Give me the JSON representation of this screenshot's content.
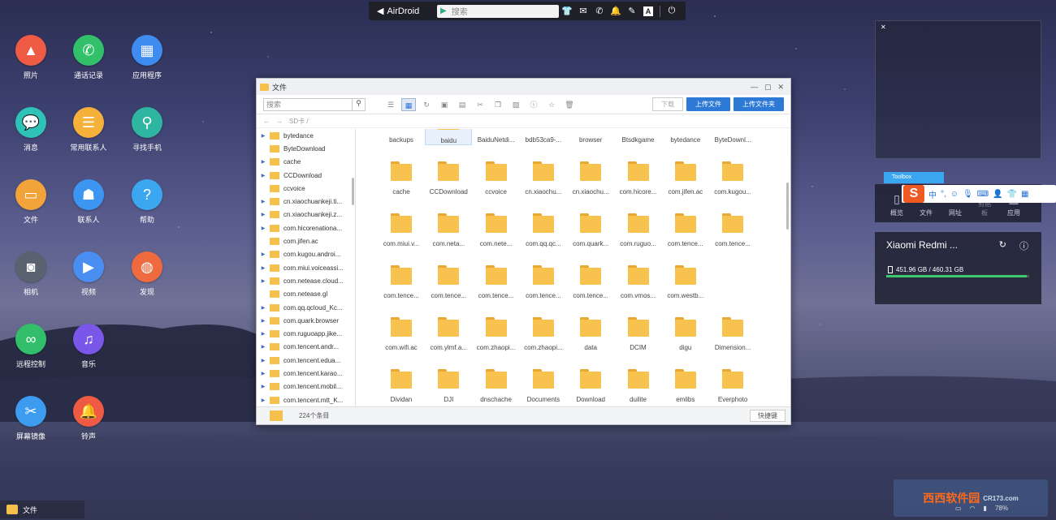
{
  "topbar": {
    "logo": "AirDroid",
    "search_placeholder": "搜索",
    "icons": [
      "shirt-icon",
      "mail-icon",
      "phone-icon",
      "bell-icon",
      "pen-icon",
      "font-icon",
      "power-icon"
    ]
  },
  "desktop": [
    {
      "label": "照片",
      "color": "#ef5b45",
      "icon": "photo-icon"
    },
    {
      "label": "通话记录",
      "color": "#33c06a",
      "icon": "phone-icon"
    },
    {
      "label": "应用程序",
      "color": "#3e8cf0",
      "icon": "apps-icon"
    },
    {
      "label": "消息",
      "color": "#2fc3b8",
      "icon": "message-icon"
    },
    {
      "label": "常用联系人",
      "color": "#f6b13a",
      "icon": "contact-card-icon"
    },
    {
      "label": "寻找手机",
      "color": "#2fb6a2",
      "icon": "location-icon"
    },
    {
      "label": "文件",
      "color": "#f2a33a",
      "icon": "folder-icon"
    },
    {
      "label": "联系人",
      "color": "#3d95f2",
      "icon": "contacts-icon"
    },
    {
      "label": "帮助",
      "color": "#3aa7f0",
      "icon": "help-icon"
    },
    {
      "label": "相机",
      "color": "#5a6270",
      "icon": "camera-icon"
    },
    {
      "label": "视频",
      "color": "#4b8ef2",
      "icon": "video-icon"
    },
    {
      "label": "发现",
      "color": "#ef6a3e",
      "icon": "planet-icon"
    },
    {
      "label": "远程控制",
      "color": "#32be6a",
      "icon": "binoculars-icon"
    },
    {
      "label": "音乐",
      "color": "#7a57e8",
      "icon": "music-icon"
    },
    {
      "label": "屏幕镜像",
      "color": "#3d9cf0",
      "icon": "scissors-icon"
    },
    {
      "label": "铃声",
      "color": "#ef5a45",
      "icon": "bell-icon"
    }
  ],
  "window": {
    "title": "文件",
    "search_placeholder": "搜索",
    "download_label": "下载",
    "upload_file_label": "上传文件",
    "upload_folder_label": "上传文件夹",
    "path": "SD卡 /",
    "status_count": "224个条目",
    "hotkey_label": "快捷键",
    "tree": [
      {
        "name": "bytedance",
        "arrow": true
      },
      {
        "name": "ByteDownload",
        "arrow": false
      },
      {
        "name": "cache",
        "arrow": true
      },
      {
        "name": "CCDownload",
        "arrow": true
      },
      {
        "name": "ccvoice",
        "arrow": false
      },
      {
        "name": "cn.xiaochuankeji.ti...",
        "arrow": true
      },
      {
        "name": "cn.xiaochuankeji.z...",
        "arrow": true
      },
      {
        "name": "com.hicorenationa...",
        "arrow": true
      },
      {
        "name": "com.jifen.ac",
        "arrow": false
      },
      {
        "name": "com.kugou.androi...",
        "arrow": true
      },
      {
        "name": "com.miui.voiceassi...",
        "arrow": true
      },
      {
        "name": "com.netease.cloud...",
        "arrow": true
      },
      {
        "name": "com.netease.gl",
        "arrow": false
      },
      {
        "name": "com.qq.qcloud_Kc...",
        "arrow": true
      },
      {
        "name": "com.quark.browser",
        "arrow": true
      },
      {
        "name": "com.ruguoapp.jike...",
        "arrow": true
      },
      {
        "name": "com.tencent.andr...",
        "arrow": true
      },
      {
        "name": "com.tencent.edua...",
        "arrow": true
      },
      {
        "name": "com.tencent.karao...",
        "arrow": true
      },
      {
        "name": "com.tencent.mobil...",
        "arrow": true
      },
      {
        "name": "com.tencent.mtt_K...",
        "arrow": true
      }
    ],
    "grid_rows": [
      [
        "backups",
        "baidu",
        "BaiduNetdi...",
        "bdb53ca9-...",
        "browser",
        "Btsdkgame",
        "bytedance",
        "ByteDownl..."
      ],
      [
        "cache",
        "CCDownload",
        "ccvoice",
        "cn.xiaochu...",
        "cn.xiaochu...",
        "com.hicore...",
        "com.jifen.ac",
        "com.kugou..."
      ],
      [
        "com.miui.v...",
        "com.neta...",
        "com.nete...",
        "com.qq.qc...",
        "com.quark...",
        "com.ruguo...",
        "com.tence...",
        "com.tence..."
      ],
      [
        "com.tence...",
        "com.tence...",
        "com.tence...",
        "com.tence...",
        "com.tence...",
        "com.vmos...",
        "com.westb..."
      ],
      [
        "com.wifi.ac",
        "com.ylmf.a...",
        "com.zhaopi...",
        "com.zhaopi...",
        "data",
        "DCIM",
        "digu",
        "Dimension..."
      ],
      [
        "Dividan",
        "DJI",
        "dnschache",
        "Documents",
        "Download",
        "duilite",
        "emlibs",
        "Everphoto"
      ]
    ],
    "selected": "baidu"
  },
  "right": {
    "toolbox_label": "Toolbox",
    "tabs": [
      "概览",
      "文件",
      "网址",
      "剪贴板",
      "应用"
    ],
    "device_name": "Xiaomi Redmi ...",
    "storage": "451.96 GB / 460.31 GB",
    "storage_fraction": 0.982,
    "ime": {
      "logo": "S",
      "lang": "中",
      "punct": "°,"
    }
  },
  "taskbar": {
    "label": "文件"
  },
  "watermark": {
    "line1": "西西软件园",
    "line2": "CR173.com"
  },
  "tray": {
    "battery": "78%"
  }
}
